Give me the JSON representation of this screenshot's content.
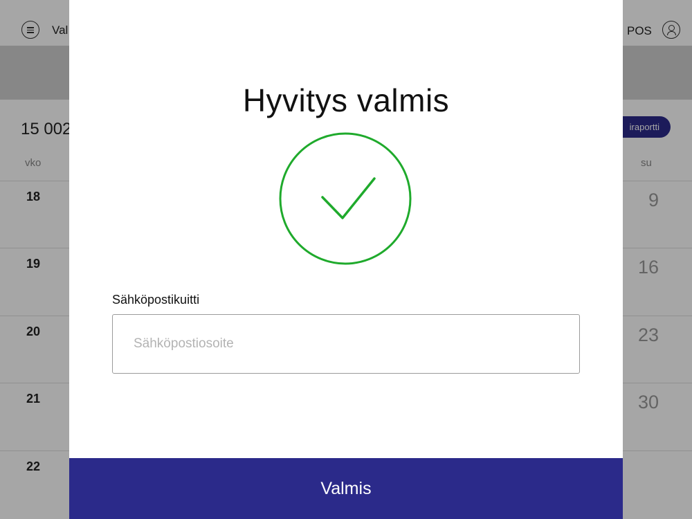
{
  "app": {
    "title": "Val",
    "pos_label": "POS",
    "total": "15 002",
    "report_button": "iraportti",
    "columns": {
      "week": "vko",
      "sunday": "su"
    },
    "weeks": [
      {
        "week": "18",
        "sunday": "9"
      },
      {
        "week": "19",
        "sunday": "16"
      },
      {
        "week": "20",
        "sunday": "23"
      },
      {
        "week": "21",
        "sunday": "30"
      },
      {
        "week": "22",
        "sunday": ""
      }
    ]
  },
  "modal": {
    "title": "Hyvitys valmis",
    "icon": "check-circle-icon",
    "email_label": "Sähköpostikuitti",
    "email_value": "",
    "email_placeholder": "Sähköpostiosoite",
    "done_button": "Valmis"
  },
  "colors": {
    "accent": "#2b2a8a",
    "success": "#1faa2c",
    "scrim": "rgba(0,0,0,0.35)"
  }
}
